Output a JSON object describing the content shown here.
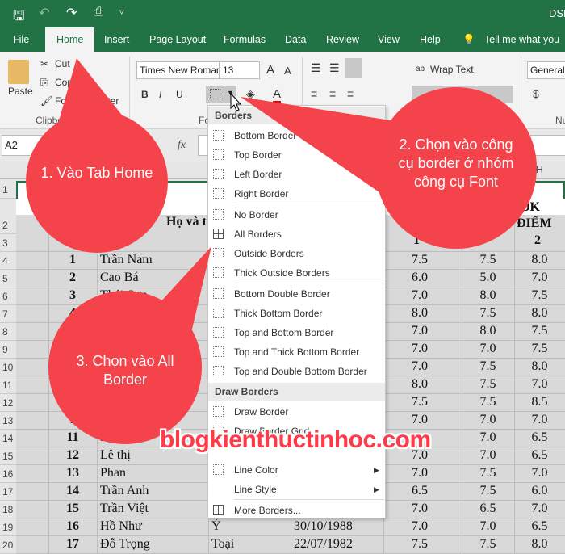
{
  "title_bar": {
    "title": "DSL",
    "icons": [
      "save-icon",
      "undo-icon",
      "redo-icon",
      "print-preview-icon",
      "customize-icon"
    ]
  },
  "tabs": [
    "File",
    "Home",
    "Insert",
    "Page Layout",
    "Formulas",
    "Data",
    "Review",
    "View",
    "Help"
  ],
  "tell_me": "Tell me what you w",
  "ribbon": {
    "paste": "Paste",
    "cut": "Cut",
    "copy": "Copy",
    "format_painter": "Format Painter",
    "clipboard_group": "Clipboard",
    "font_group": "Font",
    "font_name": "Times New Roman",
    "font_size": "13",
    "bold": "B",
    "italic": "I",
    "underline": "U",
    "wrap_text": "Wrap Text",
    "number_format": "General",
    "number_group": "Nu"
  },
  "name_box": "A2",
  "fx": "fx",
  "col_headers": [
    "A",
    "B",
    "C",
    "D",
    "E",
    "F",
    "G",
    "H"
  ],
  "headers": {
    "name": "Họ và t",
    "col_f": "1",
    "col_h1": "ĐK",
    "col_h2": "ĐIỂM",
    "col_h3": "2"
  },
  "rows": [
    {
      "stt": "1",
      "name": "Trần Nam",
      "d": "",
      "e": "",
      "f": "7.5",
      "g": "7.5",
      "h": "8.0"
    },
    {
      "stt": "2",
      "name": "Cao Bá",
      "d": "",
      "e": "",
      "f": "6.0",
      "g": "5.0",
      "h": "7.0"
    },
    {
      "stt": "3",
      "name": "Thái Sơn",
      "d": "",
      "e": "",
      "f": "7.0",
      "g": "8.0",
      "h": "7.5"
    },
    {
      "stt": "4",
      "name": "",
      "d": "",
      "e": "",
      "f": "8.0",
      "g": "7.5",
      "h": "8.0"
    },
    {
      "stt": "",
      "name": "",
      "d": "",
      "e": "",
      "f": "7.0",
      "g": "8.0",
      "h": "7.5"
    },
    {
      "stt": "",
      "name": "",
      "d": "",
      "e": "",
      "f": "7.0",
      "g": "7.0",
      "h": "7.5"
    },
    {
      "stt": "",
      "name": "",
      "d": "",
      "e": "",
      "f": "7.0",
      "g": "7.5",
      "h": "8.0"
    },
    {
      "stt": "",
      "name": "",
      "d": "",
      "e": "",
      "f": "8.0",
      "g": "7.5",
      "h": "7.0"
    },
    {
      "stt": "",
      "name": "",
      "d": "",
      "e": "",
      "f": "7.5",
      "g": "7.5",
      "h": "8.5"
    },
    {
      "stt": "1",
      "name": "",
      "d": "",
      "e": "",
      "f": "7.0",
      "g": "7.0",
      "h": "7.0"
    },
    {
      "stt": "11",
      "name": "Lê Hoàn",
      "d": "",
      "e": "",
      "f": "",
      "g": "7.0",
      "h": "6.5"
    },
    {
      "stt": "12",
      "name": "Lê thị",
      "d": "",
      "e": "",
      "f": "7.0",
      "g": "7.0",
      "h": "6.5"
    },
    {
      "stt": "13",
      "name": "Phan",
      "d": "",
      "e": "",
      "f": "7.0",
      "g": "7.5",
      "h": "7.0"
    },
    {
      "stt": "14",
      "name": "Trần Anh",
      "d": "",
      "e": "",
      "f": "6.5",
      "g": "7.5",
      "h": "6.0"
    },
    {
      "stt": "15",
      "name": "Trần Việt",
      "d": "",
      "e": "",
      "f": "7.0",
      "g": "6.5",
      "h": "7.0"
    },
    {
      "stt": "16",
      "name": "Hồ Như",
      "d": "Ý",
      "e": "30/10/1988",
      "f": "7.0",
      "g": "7.0",
      "h": "6.5"
    },
    {
      "stt": "17",
      "name": "Đỗ Trọng",
      "d": "Toại",
      "e": "22/07/1982",
      "f": "7.5",
      "g": "7.5",
      "h": "8.0"
    }
  ],
  "menu": {
    "header1": "Borders",
    "items1": [
      "Bottom Border",
      "Top Border",
      "Left Border",
      "Right Border"
    ],
    "items2": [
      "No Border",
      "All Borders",
      "Outside Borders",
      "Thick Outside Borders"
    ],
    "items3": [
      "Bottom Double Border",
      "Thick Bottom Border",
      "Top and Bottom Border",
      "Top and Thick Bottom Border",
      "Top and Double Bottom Border"
    ],
    "header2": "Draw Borders",
    "items4": [
      "Draw Border",
      "Draw Border Grid"
    ],
    "items5": [
      "Line Color",
      "Line Style"
    ],
    "more": "More Borders..."
  },
  "callouts": {
    "c1": "1. Vào Tab Home",
    "c2": "2. Chọn vào công cụ border ở nhóm công cụ Font",
    "c3": "3. Chọn vào All Border"
  },
  "watermark": "blogkienthuctinhoc.com",
  "colors": {
    "excel_green": "#217346",
    "callout_red": "#f4434a",
    "selection_gray": "#d9d9d9"
  }
}
